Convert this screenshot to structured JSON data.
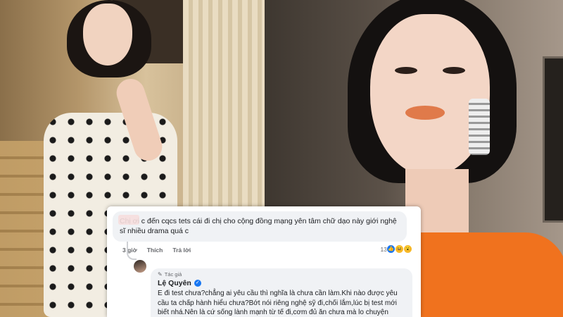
{
  "comment": {
    "text": "Chị ơi c đến cqcs tets cái đi chị cho cộng đồng mạng yên tâm chữ dạo này giới nghệ sĩ nhiều drama quá c",
    "time": "3 giờ",
    "like_label": "Thích",
    "reply_label": "Trả lời",
    "reaction_count": "13"
  },
  "reply": {
    "author_badge": "Tác giả",
    "author_name": "Lệ Quyên",
    "text": "E đi test chưa?chẳng ai yêu cầu thì nghĩa là chưa cần làm.Khi nào được yêu cầu ta chấp hành hiểu chưa?Bớt nói riêng nghệ sỹ đi,chối lắm,lúc bị test mới biết nhá.Nên là cứ sống lành mạnh từ tế đi,cơm đủ ăn chưa mà lo chuyện thiên hạ.Nín em ơi!"
  },
  "colors": {
    "accent": "#1877f2",
    "bubble": "#f0f2f5",
    "meta_text": "#65676b",
    "dress_top": "#f0721e"
  },
  "icons": [
    "like-icon",
    "haha-icon",
    "wow-icon",
    "verified-icon",
    "pen-icon"
  ]
}
